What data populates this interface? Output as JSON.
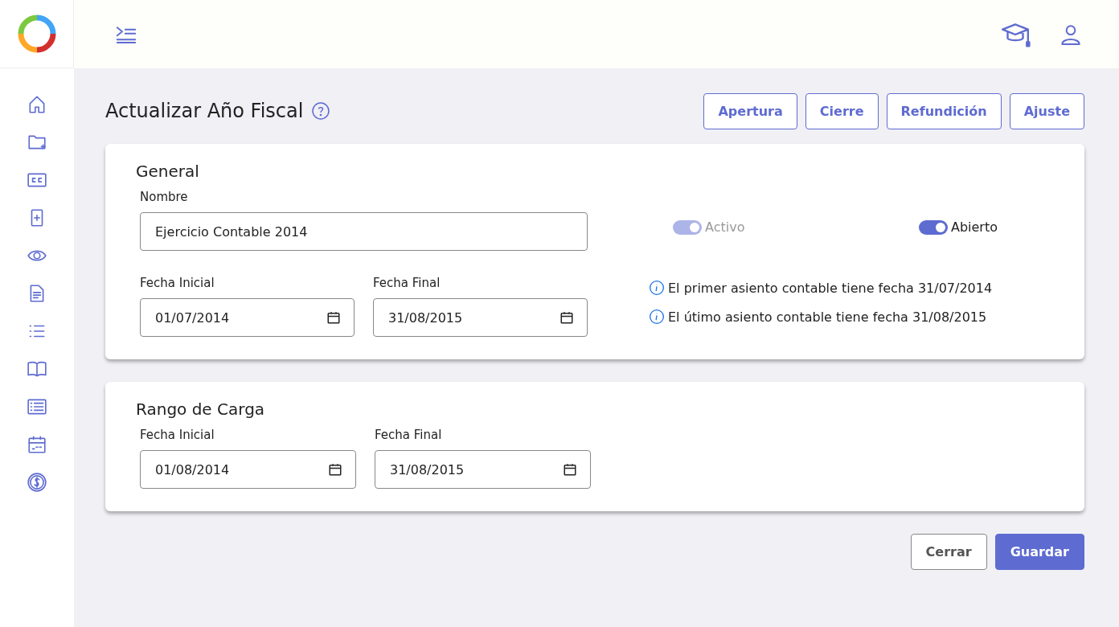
{
  "page": {
    "title": "Actualizar Año Fiscal"
  },
  "actions": [
    "Apertura",
    "Cierre",
    "Refundición",
    "Ajuste"
  ],
  "general": {
    "title": "General",
    "name_label": "Nombre",
    "name_value": "Ejercicio Contable 2014",
    "toggles": [
      {
        "label": "Activo",
        "on": true,
        "disabled": true
      },
      {
        "label": "Abierto",
        "on": true,
        "disabled": false
      }
    ],
    "start_label": "Fecha Inicial",
    "start_value": "01/07/2014",
    "end_label": "Fecha Final",
    "end_value": "31/08/2015",
    "notes": [
      "El primer asiento contable tiene fecha 31/07/2014",
      "El útimo asiento contable tiene fecha 31/08/2015"
    ]
  },
  "load_range": {
    "title": "Rango de Carga",
    "start_label": "Fecha Inicial",
    "start_value": "01/08/2014",
    "end_label": "Fecha Final",
    "end_value": "31/08/2015"
  },
  "footer": [
    {
      "label": "Cerrar",
      "kind": "secondary"
    },
    {
      "label": "Guardar",
      "kind": "primary"
    }
  ]
}
